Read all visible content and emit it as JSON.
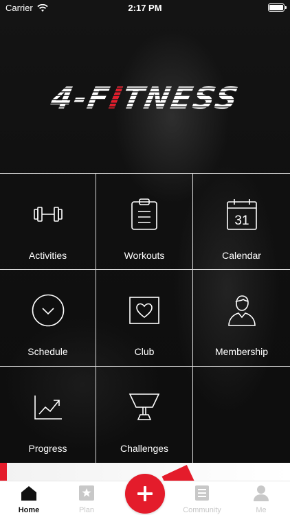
{
  "status_bar": {
    "carrier": "Carrier",
    "time": "2:17 PM"
  },
  "logo": {
    "text_pre": "4-F",
    "text_accent": "I",
    "text_post": "TNESS"
  },
  "tiles": [
    {
      "label": "Activities",
      "icon": "dumbbell-icon"
    },
    {
      "label": "Workouts",
      "icon": "clipboard-icon"
    },
    {
      "label": "Calendar",
      "icon": "calendar-icon",
      "day": "31"
    },
    {
      "label": "Schedule",
      "icon": "chevron-circle-icon"
    },
    {
      "label": "Club",
      "icon": "heart-icon"
    },
    {
      "label": "Membership",
      "icon": "person-icon"
    },
    {
      "label": "Progress",
      "icon": "trending-up-icon"
    },
    {
      "label": "Challenges",
      "icon": "trophy-icon"
    }
  ],
  "tab_bar": {
    "items": [
      {
        "label": "Home",
        "icon": "home-icon",
        "active": true
      },
      {
        "label": "Plan",
        "icon": "star-square-icon",
        "active": false
      },
      {
        "label": "Community",
        "icon": "list-icon",
        "active": false
      },
      {
        "label": "Me",
        "icon": "user-icon",
        "active": false
      }
    ]
  },
  "colors": {
    "accent": "#e41c2b",
    "tab_active": "#111111",
    "tab_inactive": "#c8c8c8"
  }
}
